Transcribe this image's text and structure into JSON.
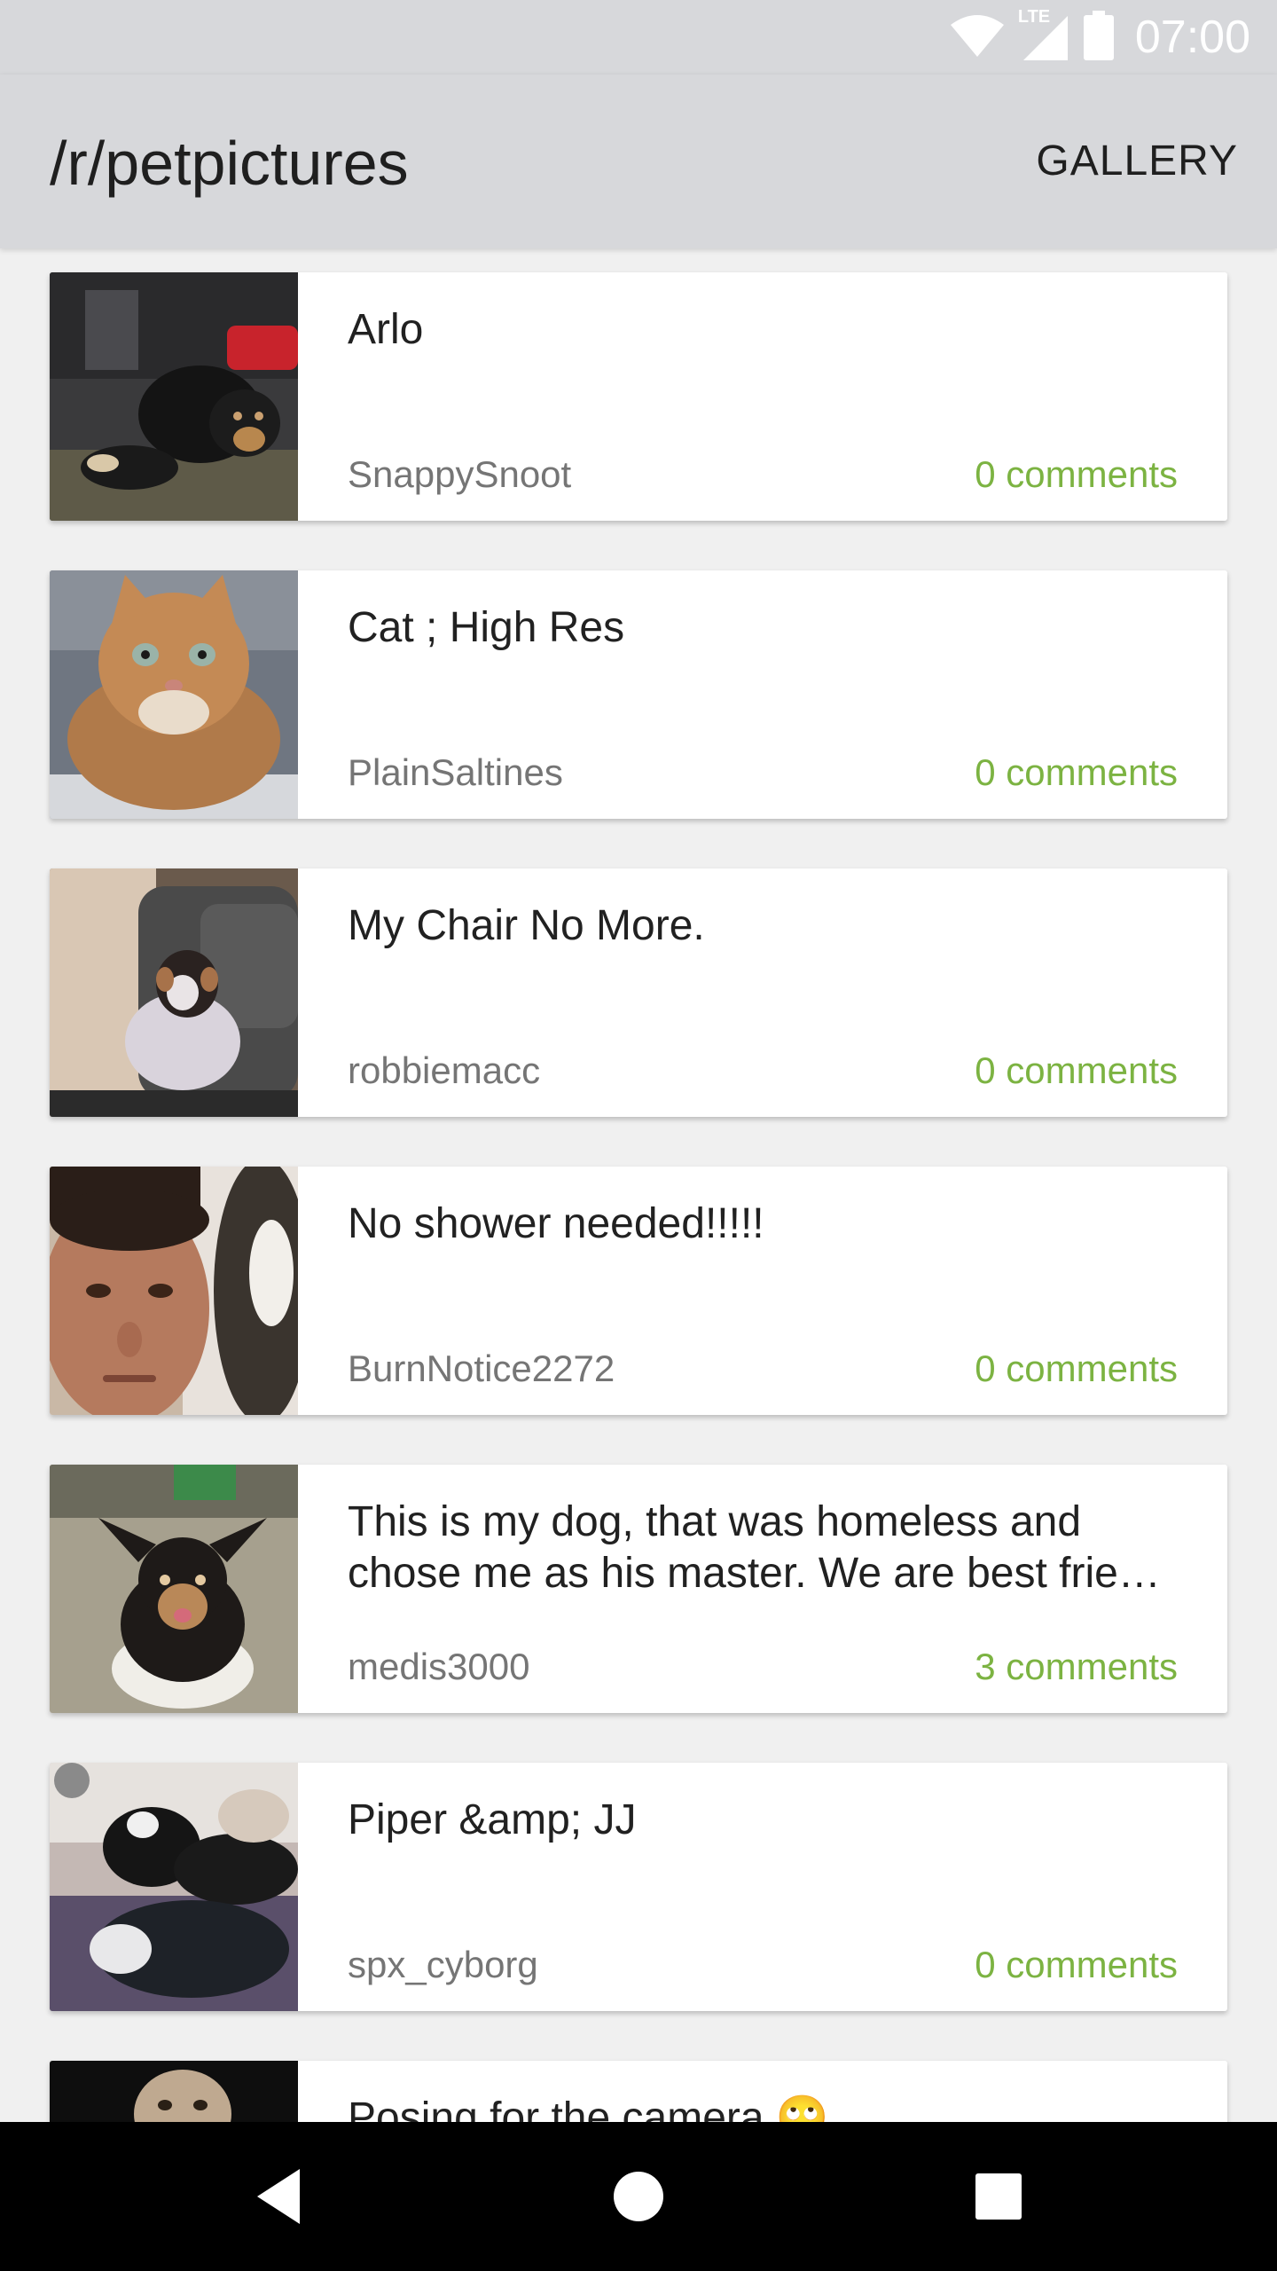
{
  "status_bar": {
    "time": "07:00",
    "network_label": "LTE",
    "icons": [
      "wifi-icon",
      "cellular-signal-icon",
      "battery-icon"
    ]
  },
  "app_bar": {
    "title": "/r/petpictures",
    "gallery_label": "GALLERY"
  },
  "colors": {
    "app_bar_bg": "#d7d8db",
    "comments_accent": "#7cb342",
    "author_text": "#757575",
    "title_text": "#212121",
    "list_bg": "#f0f0f0"
  },
  "posts": [
    {
      "title": "Arlo",
      "author": "SnappySnoot",
      "comments": "0 comments",
      "thumbnail": "puppy-in-car-image"
    },
    {
      "title": "Cat ; High Res",
      "author": "PlainSaltines",
      "comments": "0 comments",
      "thumbnail": "orange-tabby-cat-image"
    },
    {
      "title": "My Chair No More.",
      "author": "robbiemacc",
      "comments": "0 comments",
      "thumbnail": "dog-on-leather-chair-image"
    },
    {
      "title": "No shower needed!!!!!",
      "author": "BurnNotice2272",
      "comments": "0 comments",
      "thumbnail": "man-selfie-with-cat-image"
    },
    {
      "title": "This is my dog, that was homeless and chose me as his master. We are best frie…",
      "author": "medis3000",
      "comments": "3 comments",
      "thumbnail": "corgi-mix-on-carpet-image"
    },
    {
      "title": "Piper &amp; JJ",
      "author": "spx_cyborg",
      "comments": "0 comments",
      "thumbnail": "two-dogs-on-bed-image"
    },
    {
      "title": "Posing for the camera 🙄",
      "author": "",
      "comments": "",
      "thumbnail": "small-dog-posing-image"
    }
  ],
  "nav_bar": {
    "buttons": [
      "back-icon",
      "home-icon",
      "recents-icon"
    ]
  }
}
